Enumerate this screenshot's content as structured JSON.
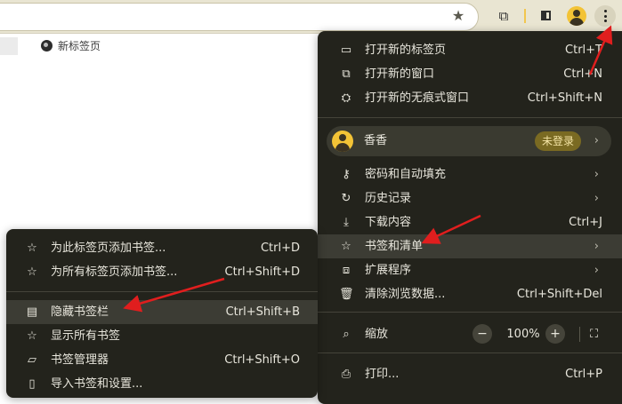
{
  "toolbar": {
    "icons": [
      "star-icon",
      "extension-icon",
      "side-panel-icon",
      "profile-avatar-icon",
      "more-menu-icon"
    ],
    "star_glyph": "★",
    "ext_glyph": "⧉",
    "accent": "#f3c336"
  },
  "bookmarks_bar": {
    "items": [
      {
        "label": "新标签页",
        "icon": "globe-icon"
      }
    ]
  },
  "main_menu": {
    "items": [
      {
        "icon": "▭",
        "label": "打开新的标签页",
        "shortcut": "Ctrl+T"
      },
      {
        "icon": "⧉",
        "label": "打开新的窗口",
        "shortcut": "Ctrl+N"
      },
      {
        "icon": "⛭",
        "label": "打开新的无痕式窗口",
        "shortcut": "Ctrl+Shift+N"
      }
    ],
    "profile": {
      "name": "香香",
      "status": "未登录",
      "chevron": "›"
    },
    "items2": [
      {
        "icon": "⚷",
        "label": "密码和自动填充",
        "shortcut": "",
        "chevron": "›"
      },
      {
        "icon": "↻",
        "label": "历史记录",
        "shortcut": "",
        "chevron": "›"
      },
      {
        "icon": "⤓",
        "label": "下载内容",
        "shortcut": "Ctrl+J"
      },
      {
        "icon": "☆",
        "label": "书签和清单",
        "shortcut": "",
        "chevron": "›"
      },
      {
        "icon": "⧈",
        "label": "扩展程序",
        "shortcut": "",
        "chevron": "›"
      },
      {
        "icon": "🗑",
        "label": "清除浏览数据...",
        "shortcut": "Ctrl+Shift+Del"
      }
    ],
    "zoom": {
      "icon": "⌕",
      "label": "缩放",
      "minus": "−",
      "value": "100%",
      "plus": "+",
      "fullscreen": "⛶"
    },
    "print": {
      "icon": "⎙",
      "label": "打印...",
      "shortcut": "Ctrl+P"
    }
  },
  "sub_menu": {
    "items": [
      {
        "icon": "☆",
        "label": "为此标签页添加书签...",
        "shortcut": "Ctrl+D"
      },
      {
        "icon": "☆",
        "label": "为所有标签页添加书签...",
        "shortcut": "Ctrl+Shift+D"
      },
      {
        "icon": "▤",
        "label": "隐藏书签栏",
        "shortcut": "Ctrl+Shift+B"
      },
      {
        "icon": "☆",
        "label": "显示所有书签",
        "shortcut": ""
      },
      {
        "icon": "▱",
        "label": "书签管理器",
        "shortcut": "Ctrl+Shift+O"
      },
      {
        "icon": "▯",
        "label": "导入书签和设置...",
        "shortcut": ""
      }
    ]
  },
  "annotation_color": "#e01e1e"
}
